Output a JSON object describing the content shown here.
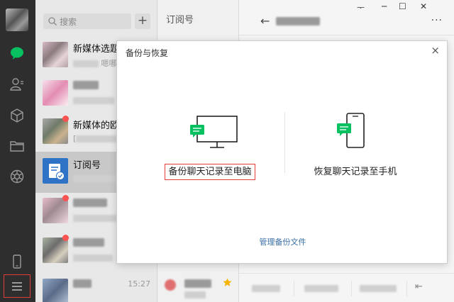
{
  "search": {
    "placeholder": "搜索"
  },
  "add_button": "+",
  "chats": [
    {
      "name": "新媒体选题",
      "sub": "嗯哪"
    },
    {
      "name": "",
      "sub": ""
    },
    {
      "name": "新媒体的欧",
      "sub": "["
    },
    {
      "name": "订阅号",
      "sub": ""
    },
    {
      "name": "",
      "sub": ""
    },
    {
      "name": "",
      "sub": ""
    },
    {
      "name": "",
      "sub": "",
      "time": "15:27"
    }
  ],
  "middle": {
    "header": "订阅号"
  },
  "window": {
    "pin": "ᅮ",
    "minimize": "─",
    "maximize": "☐",
    "close": "✕",
    "back": "←",
    "more": "···"
  },
  "dialog": {
    "title": "备份与恢复",
    "close": "×",
    "backup_label": "备份聊天记录至电脑",
    "restore_label": "恢复聊天记录至手机",
    "manage_label": "管理备份文件"
  },
  "colors": {
    "rail": "#2e2e2e",
    "accent_green": "#07c160",
    "highlight_red": "#e43b3b",
    "link_blue": "#3a6ea5"
  },
  "icons": [
    "chat-icon",
    "contacts-icon",
    "favorites-icon",
    "files-icon",
    "moments-icon",
    "phone-icon",
    "menu-icon"
  ]
}
